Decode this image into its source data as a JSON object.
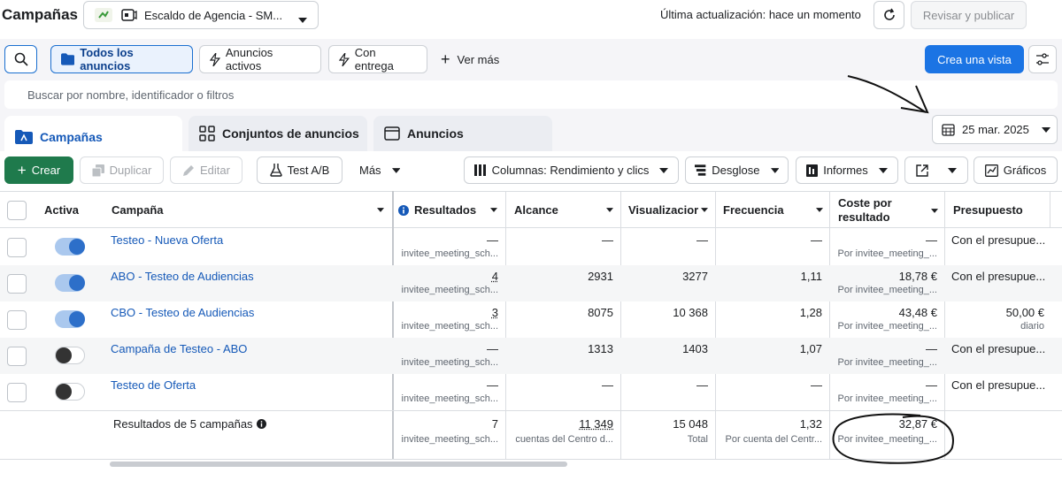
{
  "header": {
    "title": "Campañas",
    "account": "Escaldo de Agencia - SM...",
    "updated": "Última actualización: hace un momento",
    "publish": "Revisar y publicar"
  },
  "filters": {
    "all_ads": "Todos los anuncios",
    "active_ads": "Anuncios activos",
    "delivering": "Con entrega",
    "see_more": "Ver más",
    "create_view": "Crea una vista"
  },
  "search": {
    "placeholder": "Buscar por nombre, identificador o filtros"
  },
  "levels": {
    "campaigns": "Campañas",
    "adsets": "Conjuntos de anuncios",
    "ads": "Anuncios"
  },
  "date": "25 mar. 2025",
  "toolbar": {
    "create": "Crear",
    "duplicate": "Duplicar",
    "edit": "Editar",
    "ab_test": "Test A/B",
    "more": "Más",
    "columns": "Columnas: Rendimiento y clics",
    "breakdown": "Desglose",
    "reports": "Informes",
    "charts": "Gráficos"
  },
  "table": {
    "headers": {
      "active": "Activa",
      "campaign": "Campaña",
      "results": "Resultados",
      "reach": "Alcance",
      "impressions": "Visualizacior",
      "frequency": "Frecuencia",
      "cost_line1": "Coste por",
      "cost_line2": "resultado",
      "budget": "Presupuesto"
    },
    "rows": [
      {
        "name": "Testeo - Nueva Oferta",
        "active": true,
        "results": "—",
        "results_sub": "invitee_meeting_sch...",
        "reach": "—",
        "impressions": "—",
        "frequency": "—",
        "cost": "—",
        "cost_sub": "Por invitee_meeting_...",
        "budget": "Con el presupue...",
        "budget_sub": ""
      },
      {
        "name": "ABO - Testeo de Audiencias",
        "active": true,
        "results": "4",
        "results_sub": "invitee_meeting_sch...",
        "reach": "2931",
        "impressions": "3277",
        "frequency": "1,11",
        "cost": "18,78 €",
        "cost_sub": "Por invitee_meeting_...",
        "budget": "Con el presupue...",
        "budget_sub": ""
      },
      {
        "name": "CBO - Testeo de Audiencias",
        "active": true,
        "results": "3",
        "results_sub": "invitee_meeting_sch...",
        "reach": "8075",
        "impressions": "10 368",
        "frequency": "1,28",
        "cost": "43,48 €",
        "cost_sub": "Por invitee_meeting_...",
        "budget": "50,00 €",
        "budget_sub": "diario"
      },
      {
        "name": "Campaña de Testeo - ABO",
        "active": false,
        "results": "—",
        "results_sub": "invitee_meeting_sch...",
        "reach": "1313",
        "impressions": "1403",
        "frequency": "1,07",
        "cost": "—",
        "cost_sub": "Por invitee_meeting_...",
        "budget": "Con el presupue...",
        "budget_sub": ""
      },
      {
        "name": "Testeo de Oferta",
        "active": false,
        "results": "—",
        "results_sub": "invitee_meeting_sch...",
        "reach": "—",
        "impressions": "—",
        "frequency": "—",
        "cost": "—",
        "cost_sub": "Por invitee_meeting_...",
        "budget": "Con el presupue...",
        "budget_sub": ""
      }
    ],
    "totals": {
      "label": "Resultados de 5 campañas",
      "results": "7",
      "results_sub": "invitee_meeting_sch...",
      "reach": "11 349",
      "reach_sub": "cuentas del Centro d...",
      "impressions": "15 048",
      "impressions_sub": "Total",
      "frequency": "1,32",
      "frequency_sub": "Por cuenta del Centr...",
      "cost": "32,87 €",
      "cost_sub": "Por invitee_meeting_..."
    }
  }
}
